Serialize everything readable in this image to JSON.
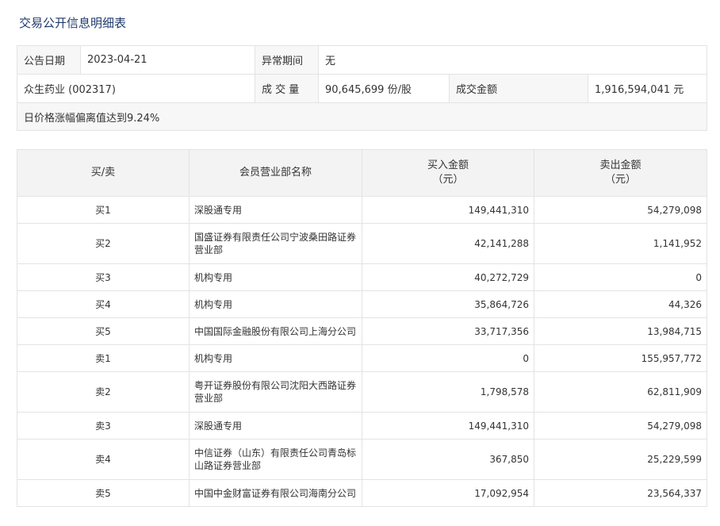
{
  "title": "交易公开信息明细表",
  "info": {
    "date_label": "公告日期",
    "date_value": "2023-04-21",
    "abnormal_label": "异常期间",
    "abnormal_value": "无",
    "stock": "众生药业 (002317)",
    "volume_label": "成 交 量",
    "volume_value": "90,645,699 份/股",
    "amount_label": "成交金额",
    "amount_value": "1,916,594,041 元",
    "notice": "日价格涨幅偏离值达到9.24%"
  },
  "table": {
    "headers": {
      "side": "买/卖",
      "dept": "会员营业部名称",
      "buy_line1": "买入金额",
      "buy_line2": "（元）",
      "sell_line1": "卖出金额",
      "sell_line2": "（元）"
    },
    "rows": [
      {
        "side": "买1",
        "dept": "深股通专用",
        "buy": "149,441,310",
        "sell": "54,279,098"
      },
      {
        "side": "买2",
        "dept": "国盛证券有限责任公司宁波桑田路证券营业部",
        "buy": "42,141,288",
        "sell": "1,141,952"
      },
      {
        "side": "买3",
        "dept": "机构专用",
        "buy": "40,272,729",
        "sell": "0"
      },
      {
        "side": "买4",
        "dept": "机构专用",
        "buy": "35,864,726",
        "sell": "44,326"
      },
      {
        "side": "买5",
        "dept": "中国国际金融股份有限公司上海分公司",
        "buy": "33,717,356",
        "sell": "13,984,715"
      },
      {
        "side": "卖1",
        "dept": "机构专用",
        "buy": "0",
        "sell": "155,957,772"
      },
      {
        "side": "卖2",
        "dept": "粤开证券股份有限公司沈阳大西路证券营业部",
        "buy": "1,798,578",
        "sell": "62,811,909"
      },
      {
        "side": "卖3",
        "dept": "深股通专用",
        "buy": "149,441,310",
        "sell": "54,279,098"
      },
      {
        "side": "卖4",
        "dept": "中信证券（山东）有限责任公司青岛标山路证券营业部",
        "buy": "367,850",
        "sell": "25,229,599"
      },
      {
        "side": "卖5",
        "dept": "中国中金财富证券有限公司海南分公司",
        "buy": "17,092,954",
        "sell": "23,564,337"
      }
    ]
  }
}
